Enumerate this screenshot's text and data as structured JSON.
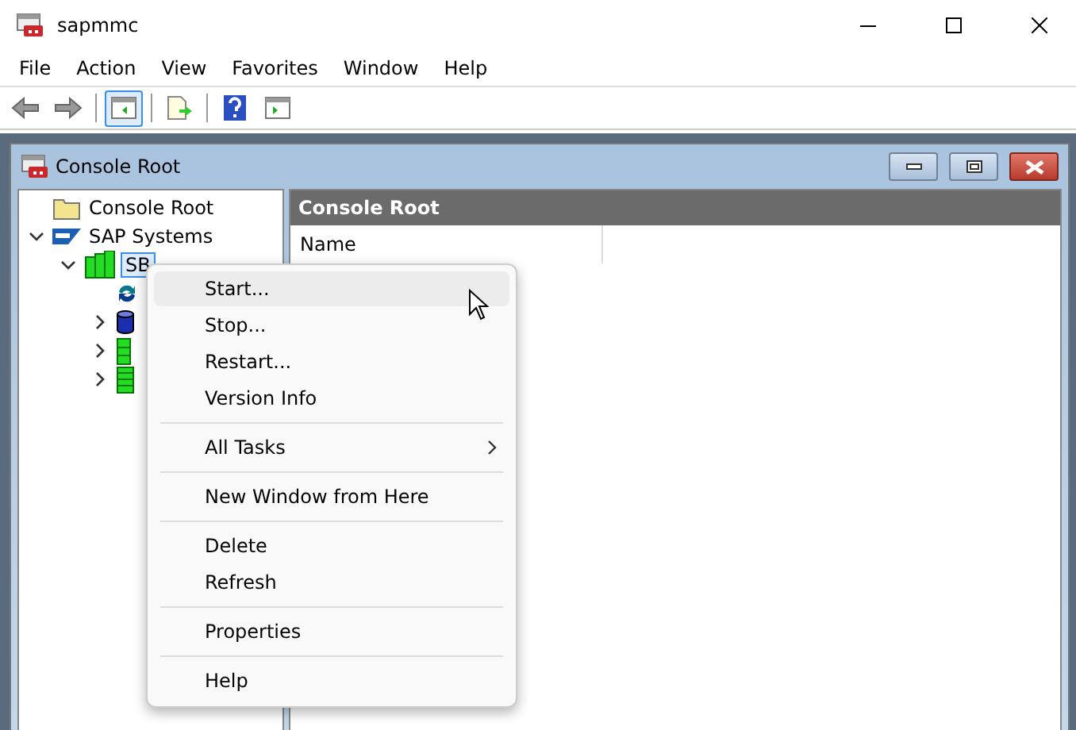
{
  "window": {
    "title": "sapmmc"
  },
  "menu_bar": [
    "File",
    "Action",
    "View",
    "Favorites",
    "Window",
    "Help"
  ],
  "toolbar": [
    {
      "kind": "back",
      "disabled": true
    },
    {
      "kind": "forward",
      "disabled": true
    },
    {
      "kind": "sep"
    },
    {
      "kind": "tree",
      "selected": true
    },
    {
      "kind": "sep"
    },
    {
      "kind": "export",
      "selected": false
    },
    {
      "kind": "sep"
    },
    {
      "kind": "help",
      "selected": false
    },
    {
      "kind": "pane",
      "selected": false
    }
  ],
  "child_window": {
    "title": "Console Root"
  },
  "tree": [
    {
      "label": "Console Root",
      "kind": "folder",
      "selected": false
    },
    {
      "label": "SAP Systems",
      "kind": "sap",
      "expanded": true,
      "selected": false,
      "children": [
        {
          "label": "SB",
          "kind": "system",
          "expanded": true,
          "selected": true,
          "children": [
            {
              "kind": "refresh"
            },
            {
              "kind": "database",
              "expanded": false
            },
            {
              "kind": "server",
              "expanded": false
            },
            {
              "kind": "server2",
              "expanded": false
            }
          ]
        }
      ]
    }
  ],
  "details": {
    "header": "Console Root",
    "columns": [
      "Name"
    ]
  },
  "context_menu": [
    {
      "kind": "item",
      "label": "Start...",
      "selected": true
    },
    {
      "kind": "item",
      "label": "Stop...",
      "selected": false
    },
    {
      "kind": "item",
      "label": "Restart...",
      "selected": false
    },
    {
      "kind": "item",
      "label": "Version Info",
      "selected": false
    },
    {
      "kind": "separator"
    },
    {
      "kind": "submenu",
      "label": "All Tasks",
      "selected": false
    },
    {
      "kind": "separator"
    },
    {
      "kind": "item",
      "label": "New Window from Here",
      "selected": false
    },
    {
      "kind": "separator"
    },
    {
      "kind": "item",
      "label": "Delete",
      "selected": false
    },
    {
      "kind": "item",
      "label": "Refresh",
      "selected": false
    },
    {
      "kind": "separator"
    },
    {
      "kind": "item",
      "label": "Properties",
      "selected": false
    },
    {
      "kind": "separator"
    },
    {
      "kind": "item",
      "label": "Help",
      "selected": false
    }
  ]
}
